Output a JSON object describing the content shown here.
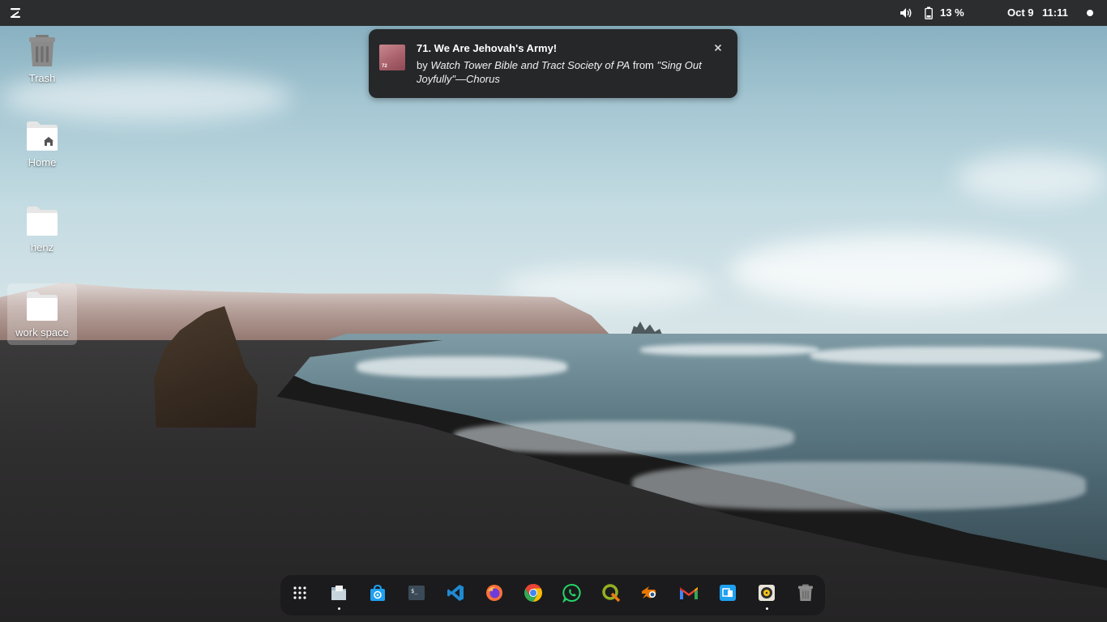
{
  "topbar": {
    "logo_icon": "zorin-menu-icon",
    "volume_icon": "speaker-icon",
    "battery_icon": "battery-icon",
    "battery_text": "13 %",
    "date": "Oct 9",
    "time": "11:11",
    "status_dot_icon": "notification-dot-icon"
  },
  "desktop": {
    "icons": [
      {
        "label": "Trash",
        "icon": "trash-icon"
      },
      {
        "label": "Home",
        "icon": "home-folder-icon"
      },
      {
        "label": "henz",
        "icon": "folder-icon"
      },
      {
        "label": "work space",
        "icon": "folder-icon",
        "selected": true
      }
    ]
  },
  "notification": {
    "title": "71. We Are Jehovah's Army!",
    "art_number": "72",
    "by_prefix": "by ",
    "artist": "Watch Tower Bible and Tract Society of PA",
    "from_word": " from ",
    "album": "\"Sing Out Joyfully\"—Chorus",
    "close_icon": "close-icon"
  },
  "dock": {
    "items": [
      {
        "name": "app-grid",
        "icon": "app-grid-icon",
        "running": false
      },
      {
        "name": "files",
        "icon": "files-icon",
        "running": true
      },
      {
        "name": "software-store",
        "icon": "software-store-icon",
        "running": false
      },
      {
        "name": "terminal",
        "icon": "terminal-icon",
        "running": false
      },
      {
        "name": "vscode",
        "icon": "vscode-icon",
        "running": false
      },
      {
        "name": "firefox",
        "icon": "firefox-icon",
        "running": false
      },
      {
        "name": "chrome",
        "icon": "chrome-icon",
        "running": false
      },
      {
        "name": "whatsapp",
        "icon": "whatsapp-icon",
        "running": false
      },
      {
        "name": "qgis",
        "icon": "qgis-icon",
        "running": false
      },
      {
        "name": "blender",
        "icon": "blender-icon",
        "running": false
      },
      {
        "name": "gmail",
        "icon": "gmail-icon",
        "running": false
      },
      {
        "name": "remote-desktop",
        "icon": "remote-desktop-icon",
        "running": false
      },
      {
        "name": "rhythmbox",
        "icon": "rhythmbox-icon",
        "running": true
      },
      {
        "name": "trash",
        "icon": "trash-icon",
        "running": false
      }
    ]
  },
  "colors": {
    "topbar_bg": "#2b2d2f",
    "notification_bg": "#262729",
    "dock_bg": "#1a1a1c"
  }
}
